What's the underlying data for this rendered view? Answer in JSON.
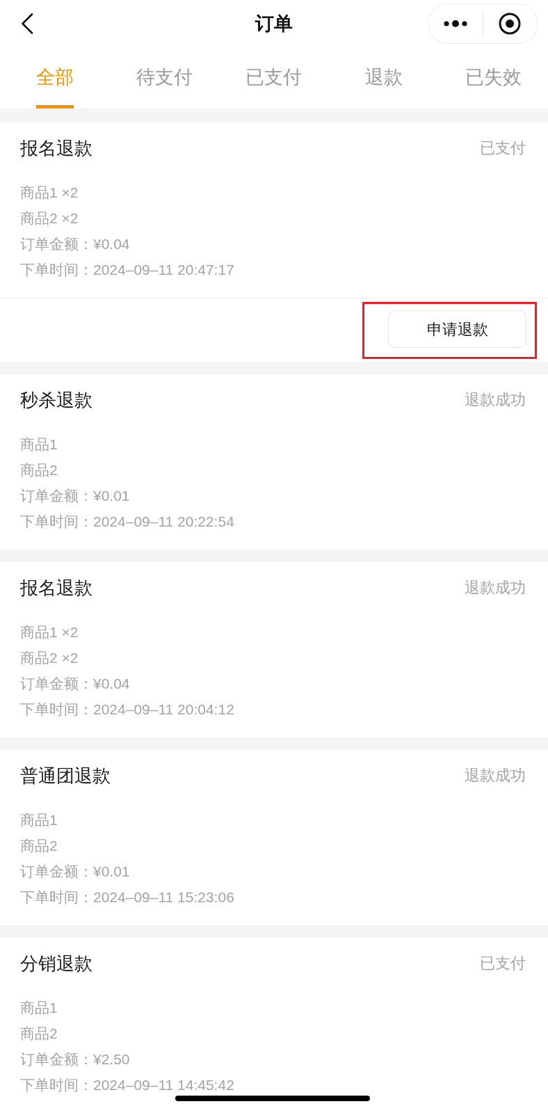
{
  "nav": {
    "title": "订单"
  },
  "tabs": [
    {
      "label": "全部",
      "selected": true
    },
    {
      "label": "待支付",
      "selected": false
    },
    {
      "label": "已支付",
      "selected": false
    },
    {
      "label": "退款",
      "selected": false
    },
    {
      "label": "已失效",
      "selected": false
    }
  ],
  "orders": [
    {
      "title": "报名退款",
      "status": "已支付",
      "products": [
        "商品1 ×2",
        "商品2 ×2"
      ],
      "amount": "订单金额：¥0.04",
      "time": "下单时间：2024–09–11 20:47:17",
      "action": {
        "label": "申请退款",
        "highlighted": true
      }
    },
    {
      "title": "秒杀退款",
      "status": "退款成功",
      "products": [
        "商品1",
        "商品2"
      ],
      "amount": "订单金额：¥0.01",
      "time": "下单时间：2024–09–11 20:22:54"
    },
    {
      "title": "报名退款",
      "status": "退款成功",
      "products": [
        "商品1 ×2",
        "商品2 ×2"
      ],
      "amount": "订单金额：¥0.04",
      "time": "下单时间：2024–09–11 20:04:12"
    },
    {
      "title": "普通团退款",
      "status": "退款成功",
      "products": [
        "商品1",
        "商品2"
      ],
      "amount": "订单金额：¥0.01",
      "time": "下单时间：2024–09–11 15:23:06"
    },
    {
      "title": "分销退款",
      "status": "已支付",
      "products": [
        "商品1",
        "商品2"
      ],
      "amount": "订单金额：¥2.50",
      "time": "下单时间：2024–09–11 14:45:42"
    }
  ]
}
